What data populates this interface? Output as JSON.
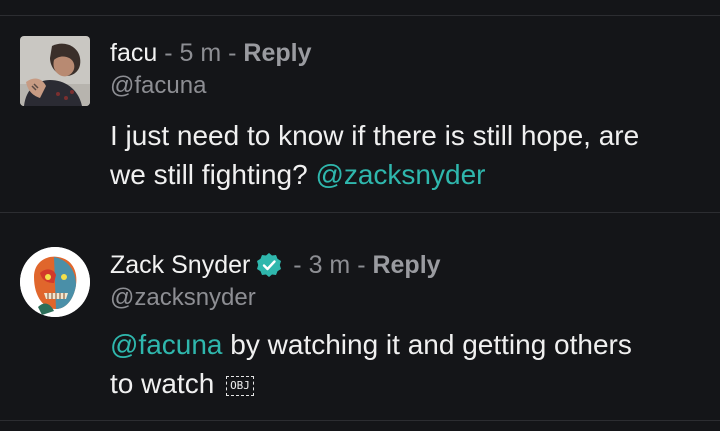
{
  "comments": [
    {
      "name": "facu",
      "sep1": " - ",
      "time": "5 m",
      "sep2": " - ",
      "reply": "Reply",
      "handle": "@facuna",
      "text": "I just need to know if there is still hope, are we still fighting? ",
      "mention": "@zacksnyder"
    },
    {
      "name": "Zack Snyder",
      "sep1": " - ",
      "time": "3 m",
      "sep2": " - ",
      "reply": "Reply",
      "handle": "@zacksnyder",
      "mention": "@facuna",
      "text": " by watching it and getting others to watch ",
      "obj": "OBJ"
    }
  ],
  "colors": {
    "accent": "#2fb7ad",
    "verified": "#2fb7ad",
    "background": "#141518"
  },
  "icons": {
    "verified": "verified-check-icon"
  }
}
